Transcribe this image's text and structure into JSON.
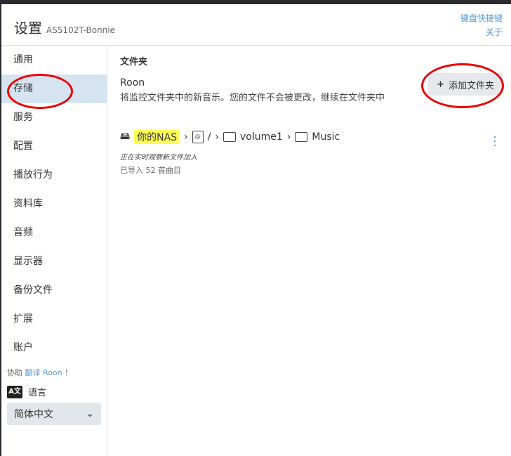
{
  "header": {
    "title": "设置",
    "device": "AS5102T-Bonnie",
    "links": [
      "键盘快捷键",
      "关于"
    ]
  },
  "sidebar": {
    "items": [
      "通用",
      "存储",
      "服务",
      "配置",
      "播放行为",
      "资料库",
      "音频",
      "显示器",
      "备份文件",
      "扩展",
      "账户"
    ],
    "help_prefix": "协助",
    "help_link": "翻译 Roon",
    "help_suffix": "！",
    "language_label": "语言",
    "language_icon": "A文",
    "language_value": "简体中文"
  },
  "main": {
    "section": "文件夹",
    "app": "Roon",
    "description": "将监控文件夹中的新音乐。您的文件不会被更改，继续在文件夹中",
    "add_button": "添加文件夹",
    "path": {
      "nas": "你的NAS",
      "root": "/",
      "folder1": "volume1",
      "folder2": "Music"
    },
    "status": "正在实时观察新文件加入",
    "count": "已导入 52 首曲目"
  }
}
